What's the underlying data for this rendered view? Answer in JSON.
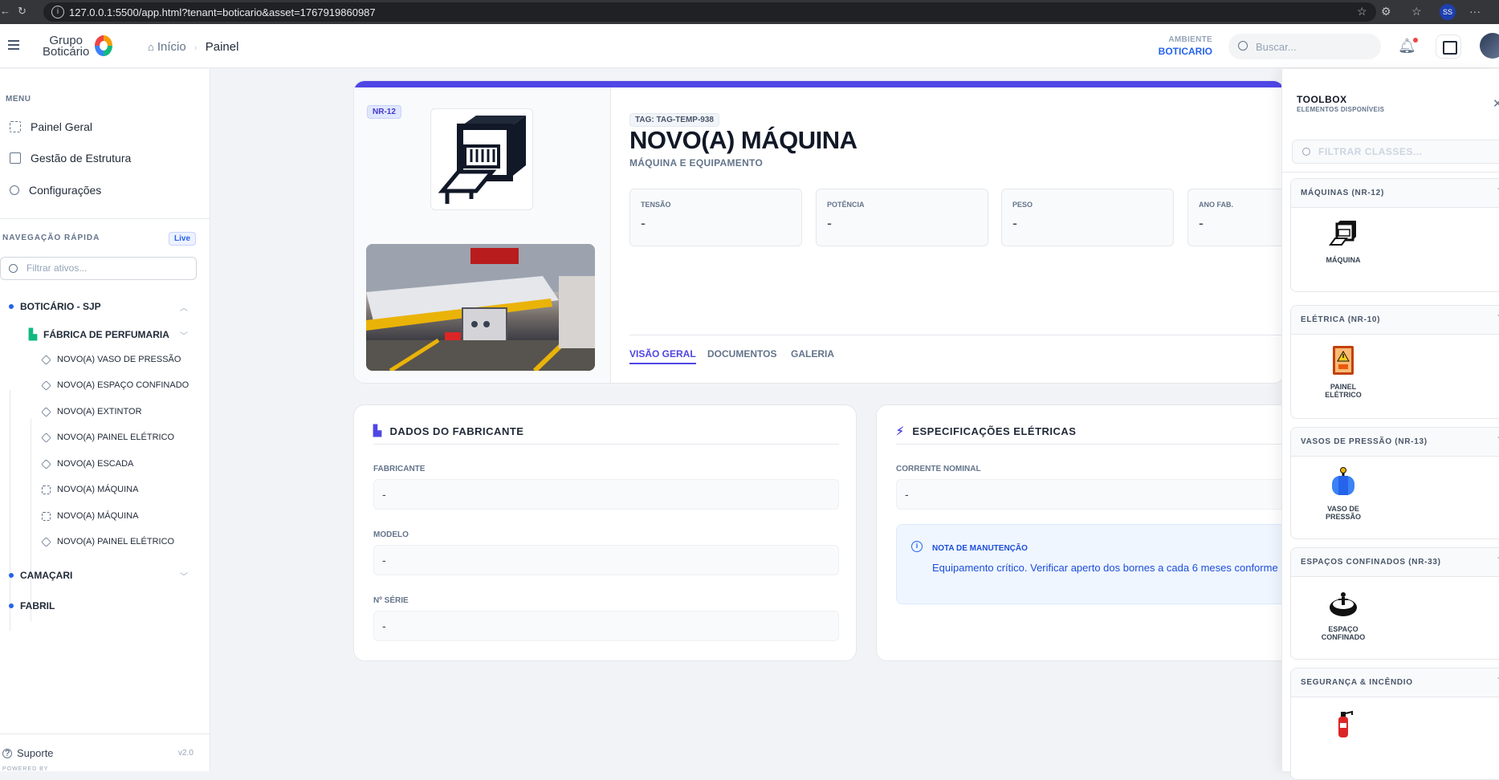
{
  "browser": {
    "url": "127.0.0.1:5500/app.html?tenant=boticario&asset=1767919860987"
  },
  "header": {
    "logo_line1": "Grupo",
    "logo_line2": "Boticário",
    "breadcrumb_home": "Início",
    "breadcrumb_current": "Painel",
    "env_label": "AMBIENTE",
    "env_value": "BOTICARIO",
    "search_placeholder": "Buscar..."
  },
  "sidebar": {
    "menu_label": "MENU",
    "items": [
      {
        "label": "Painel Geral",
        "icon": "grid-icon"
      },
      {
        "label": "Gestão de Estrutura",
        "icon": "map-icon"
      },
      {
        "label": "Configurações",
        "icon": "sliders-icon"
      }
    ],
    "quick_nav_label": "NAVEGAÇÃO RÁPIDA",
    "live_badge": "Live",
    "filter_placeholder": "Filtrar ativos...",
    "tree": {
      "site1": "BOTICÁRIO - SJP",
      "factory": "FÁBRICA DE PERFUMARIA",
      "assets": [
        {
          "label": "NOVO(A) VASO DE PRESSÃO",
          "icon": "cube-icon"
        },
        {
          "label": "NOVO(A) ESPAÇO CONFINADO",
          "icon": "cube-icon"
        },
        {
          "label": "NOVO(A) EXTINTOR",
          "icon": "cube-icon"
        },
        {
          "label": "NOVO(A) PAINEL ELÉTRICO",
          "icon": "cube-icon"
        },
        {
          "label": "NOVO(A) ESCADA",
          "icon": "cube-icon"
        },
        {
          "label": "NOVO(A) MÁQUINA",
          "icon": "cpu-icon"
        },
        {
          "label": "NOVO(A) MÁQUINA",
          "icon": "cpu-icon"
        },
        {
          "label": "NOVO(A) PAINEL ELÉTRICO",
          "icon": "cube-icon"
        }
      ],
      "site2": "CAMAÇARI",
      "site3": "FABRIL"
    },
    "support": "Suporte",
    "version": "v2.0",
    "powered": "POWERED BY"
  },
  "asset": {
    "norm_badge": "NR-12",
    "tag": "TAG: TAG-TEMP-938",
    "title": "NOVO(A) MÁQUINA",
    "subtitle": "MÁQUINA E EQUIPAMENTO",
    "specs": [
      {
        "label": "TENSÃO",
        "value": "-"
      },
      {
        "label": "POTÊNCIA",
        "value": "-"
      },
      {
        "label": "PESO",
        "value": "-"
      },
      {
        "label": "ANO FAB.",
        "value": "-"
      }
    ],
    "tabs": [
      "VISÃO GERAL",
      "DOCUMENTOS",
      "GALERIA"
    ],
    "active_tab": "VISÃO GERAL"
  },
  "manufacturer_card": {
    "title": "DADOS DO FABRICANTE",
    "fields": [
      {
        "label": "FABRICANTE",
        "value": "-"
      },
      {
        "label": "MODELO",
        "value": "-"
      },
      {
        "label": "Nº SÉRIE",
        "value": "-"
      }
    ]
  },
  "electrical_card": {
    "title": "ESPECIFICAÇÕES ELÉTRICAS",
    "fields": [
      {
        "label": "CORRENTE NOMINAL",
        "value": "-"
      }
    ],
    "note_title": "NOTA DE MANUTENÇÃO",
    "note_body": "Equipamento crítico. Verificar aperto dos bornes a cada 6 meses conforme p preventivo."
  },
  "toolbox": {
    "title": "TOOLBOX",
    "subtitle": "ELEMENTOS DISPONÍVEIS",
    "filter_placeholder": "FILTRAR CLASSES...",
    "sections": [
      {
        "header": "MÁQUINAS (NR-12)",
        "item": "MÁQUINA",
        "icon": "machine-icon"
      },
      {
        "header": "ELÉTRICA (NR-10)",
        "item": "PAINEL ELÉTRICO",
        "icon": "electrical-panel-icon"
      },
      {
        "header": "VASOS DE PRESSÃO (NR-13)",
        "item": "VASO DE PRESSÃO",
        "icon": "pressure-vessel-icon"
      },
      {
        "header": "ESPAÇOS CONFINADOS (NR-33)",
        "item": "ESPAÇO CONFINADO",
        "icon": "confined-space-icon"
      },
      {
        "header": "SEGURANÇA & INCÊNDIO",
        "item": "",
        "icon": "fire-extinguisher-icon"
      }
    ]
  },
  "colors": {
    "accent": "#4f46e5",
    "link": "#2563eb",
    "note_bg": "#eff6ff"
  }
}
